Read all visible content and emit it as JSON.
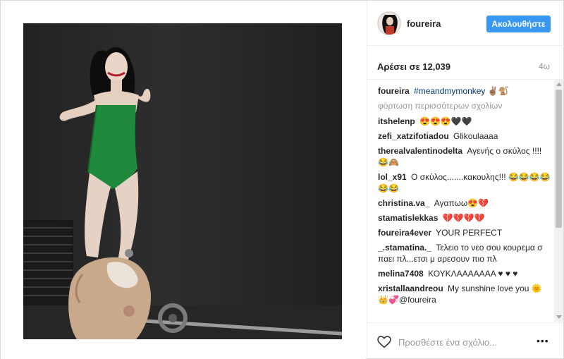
{
  "post": {
    "username": "foureira",
    "follow_label": "Ακολουθήστε",
    "likes_text": "Αρέσει σε 12,039",
    "age": "4ω"
  },
  "caption": {
    "user": "foureira",
    "hashtag": "#meandmymonkey",
    "emoji": "✌🏽🐒"
  },
  "load_more_label": "φόρτωση περισσότερων σχολίων",
  "comments": [
    {
      "user": "itshelenp",
      "text": "😍😍😍🖤🖤"
    },
    {
      "user": "zefi_xatzifotiadou",
      "text": "Glikoulaaaa"
    },
    {
      "user": "therealvalentinodelta",
      "text": "Αγενής ο σκύλος !!!! 😂🙈"
    },
    {
      "user": "lol_x91",
      "text": "Ο σκύλος.......κακουλης!!! 😂😂😂😂😂😂"
    },
    {
      "user": "christina.va_",
      "text": "Αγαπωω😍💔"
    },
    {
      "user": "stamatislekkas",
      "text": "💔💔💔💔"
    },
    {
      "user": "foureira4ever",
      "text": "YOUR PERFECT"
    },
    {
      "user": "_.stamatina._",
      "text": "Τελειο το νεο σου κουρεμα σ παει πλ...ετσι μ αρεσουν πιο πλ"
    },
    {
      "user": "melina7408",
      "text": "ΚΟΥΚΛΑΑΑΑΑΑΑ ♥ ♥ ♥"
    },
    {
      "user": "xristallaandreou",
      "text": "My sunshine love you 🌞👑💞@foureira"
    }
  ],
  "comment_placeholder": "Προσθέστε ένα σχόλιο...",
  "more_label": "•••",
  "colors": {
    "accent": "#3897f0",
    "border": "#efefef",
    "muted": "#999999"
  },
  "icons": {
    "like": "heart-outline-icon",
    "more": "more-options-icon"
  }
}
